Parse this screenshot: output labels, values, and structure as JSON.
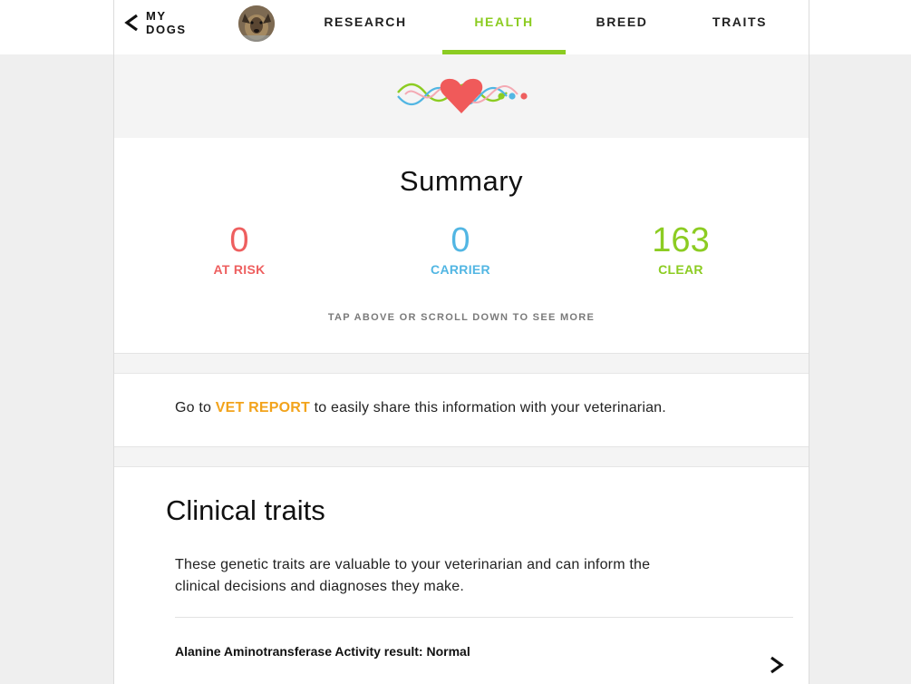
{
  "header": {
    "back_label": "MY DOGS",
    "tabs": [
      {
        "label": "RESEARCH",
        "active": false
      },
      {
        "label": "HEALTH",
        "active": true
      },
      {
        "label": "BREED",
        "active": false
      },
      {
        "label": "TRAITS",
        "active": false
      }
    ]
  },
  "icons": {
    "back": "chevron-left-icon",
    "hero": "heart-dna-icon",
    "row": "chevron-right-icon"
  },
  "summary": {
    "title": "Summary",
    "stats": [
      {
        "value": "0",
        "label": "AT RISK",
        "color": "#ee5f5f"
      },
      {
        "value": "0",
        "label": "CARRIER",
        "color": "#52b6e3"
      },
      {
        "value": "163",
        "label": "CLEAR",
        "color": "#8ccc22"
      }
    ],
    "hint": "TAP ABOVE OR SCROLL DOWN TO SEE MORE"
  },
  "vet": {
    "prefix": "Go to ",
    "link": "VET REPORT",
    "suffix": " to easily share this information with your veterinarian."
  },
  "clinical": {
    "title": "Clinical traits",
    "description": "These genetic traits are valuable to your veterinarian and can inform the clinical decisions and diagnoses they make.",
    "items": [
      {
        "label": "Alanine Aminotransferase Activity result: Normal"
      }
    ]
  },
  "colors": {
    "accent_green": "#8ccc22",
    "risk_red": "#ee5f5f",
    "carrier_blue": "#52b6e3",
    "link_orange": "#f2a31b"
  }
}
